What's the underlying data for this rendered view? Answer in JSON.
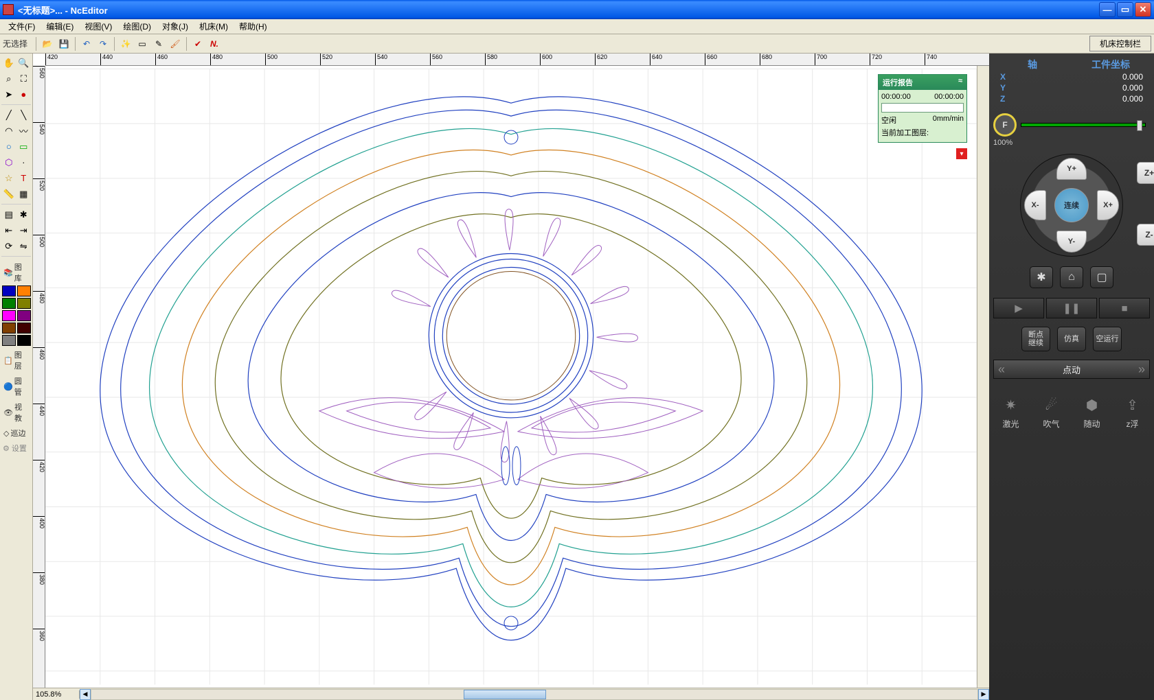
{
  "title_bar": {
    "title": "<无标题>... - NcEditor"
  },
  "menu": {
    "file": "文件(F)",
    "edit": "编辑(E)",
    "view": "视图(V)",
    "draw": "绘图(D)",
    "object": "对象(J)",
    "machine": "机床(M)",
    "help": "帮助(H)"
  },
  "toolbar": {
    "no_select": "无选择",
    "control_panel": "机床控制栏"
  },
  "left": {
    "library": "图库",
    "layer": "图层",
    "tube": "圆管",
    "teach": "视教",
    "edge": "巡边",
    "settings": "设置"
  },
  "palette_colors": [
    "#0000c0",
    "#ff8000",
    "#008000",
    "#808000",
    "#ff00ff",
    "#800080",
    "#804000",
    "#400000",
    "#808080",
    "#000000"
  ],
  "ruler_h": [
    "420",
    "440",
    "460",
    "480",
    "500",
    "520",
    "540",
    "560",
    "580",
    "600",
    "620",
    "640",
    "660",
    "680",
    "700",
    "720",
    "740"
  ],
  "ruler_v": [
    "560",
    "540",
    "520",
    "500",
    "480",
    "460",
    "440",
    "420",
    "400",
    "380",
    "360"
  ],
  "run_report": {
    "title": "运行报告",
    "time1": "00:00:00",
    "time2": "00:00:00",
    "status": "空闲",
    "speed": "0mm/min",
    "layer_label": "当前加工图层:"
  },
  "status": {
    "zoom": "105.8%"
  },
  "panel": {
    "axis_hdr": "轴",
    "wcs_hdr": "工件坐标",
    "axes": [
      {
        "name": "X",
        "val": "0.000"
      },
      {
        "name": "Y",
        "val": "0.000"
      },
      {
        "name": "Z",
        "val": "0.000"
      }
    ],
    "feed_label": "F",
    "feed_pct": "100%",
    "jog": {
      "yp": "Y+",
      "ym": "Y-",
      "xp": "X+",
      "xm": "X-",
      "zp": "Z+",
      "zm": "Z-",
      "center": "连续"
    },
    "modes": {
      "breakpoint": "断点\n继续",
      "sim": "仿真",
      "dryrun": "空运行"
    },
    "jog_tab": "点动",
    "funcs": [
      {
        "icon": "✷",
        "label": "激光"
      },
      {
        "icon": "☄",
        "label": "吹气"
      },
      {
        "icon": "⬢",
        "label": "随动"
      },
      {
        "icon": "⇪",
        "label": "z浮"
      }
    ]
  }
}
